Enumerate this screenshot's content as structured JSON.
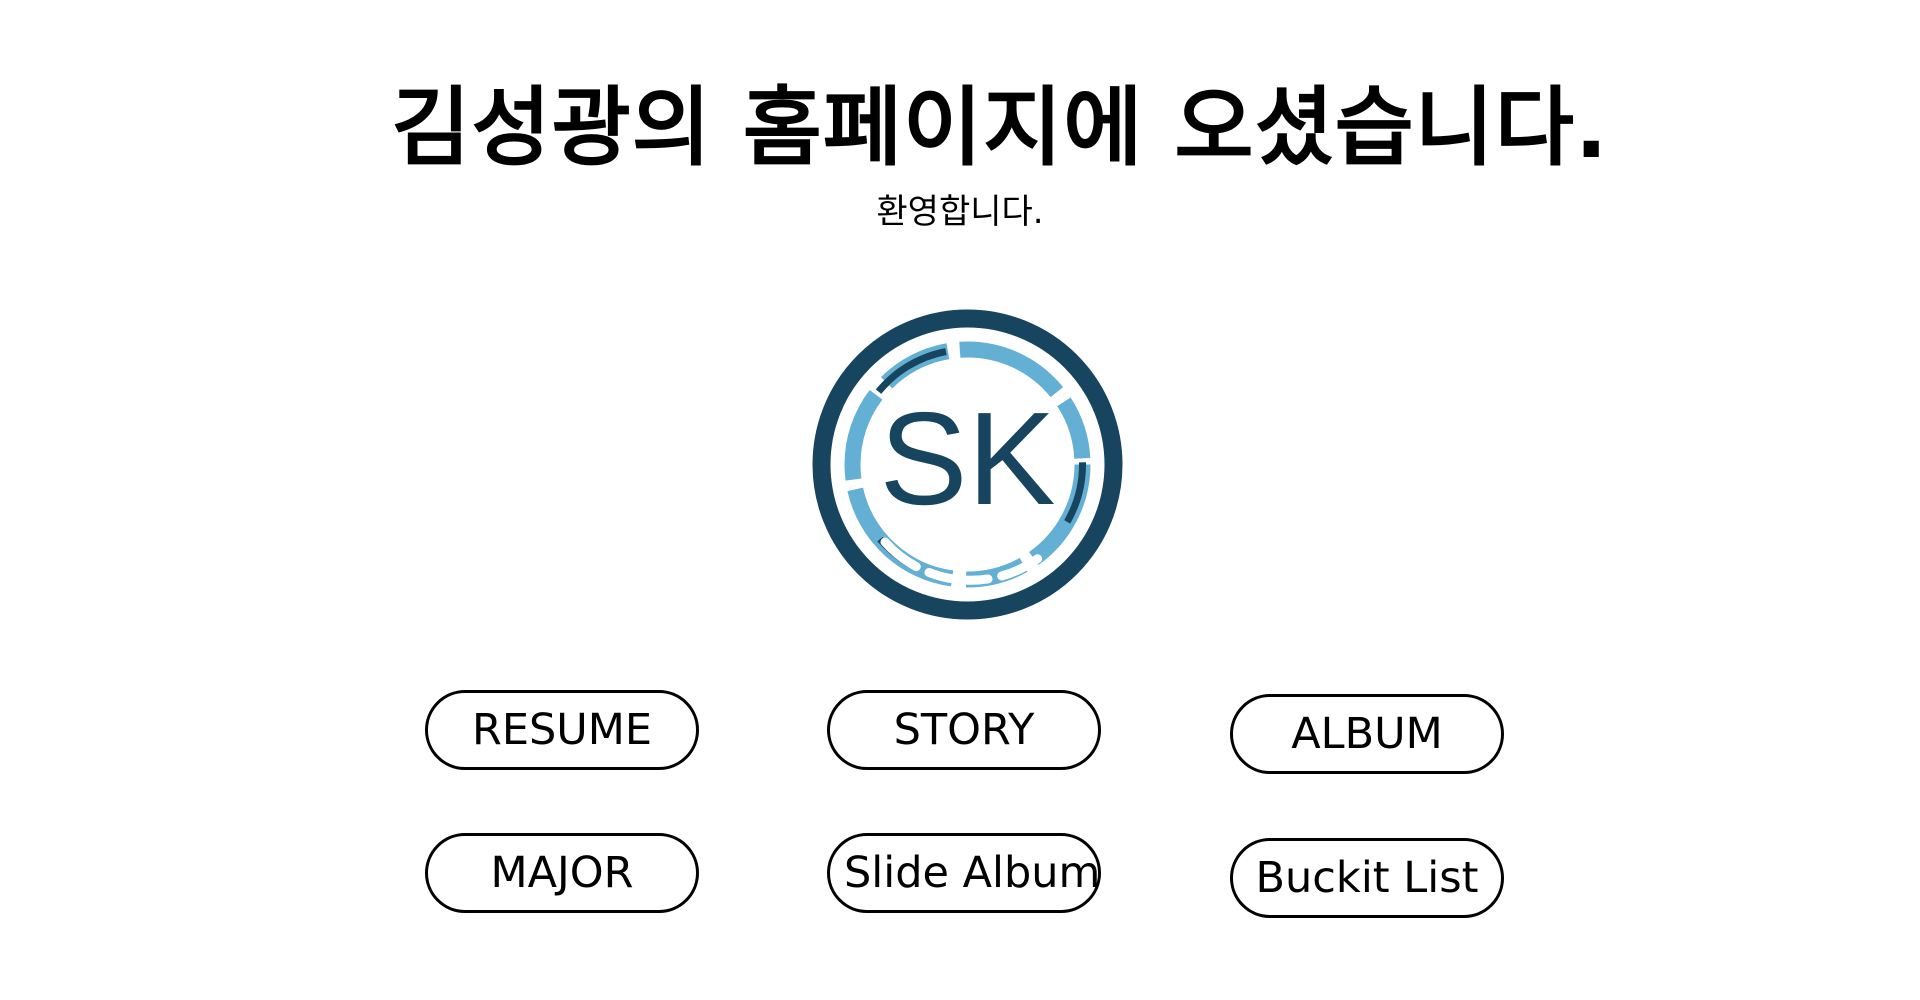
{
  "header": {
    "title": "김성광의 홈페이지에 오셨습니다.",
    "subtitle": "환영합니다."
  },
  "logo": {
    "letters": "SK",
    "icon": "sk-monogram-logo",
    "colors": {
      "dark": "#17445f",
      "light": "#63b0d4",
      "white": "#ffffff"
    }
  },
  "nav": {
    "buttons": [
      {
        "label": "RESUME"
      },
      {
        "label": "STORY"
      },
      {
        "label": "ALBUM"
      },
      {
        "label": "MAJOR"
      },
      {
        "label": "Slide Album"
      },
      {
        "label": "Buckit List"
      }
    ]
  }
}
